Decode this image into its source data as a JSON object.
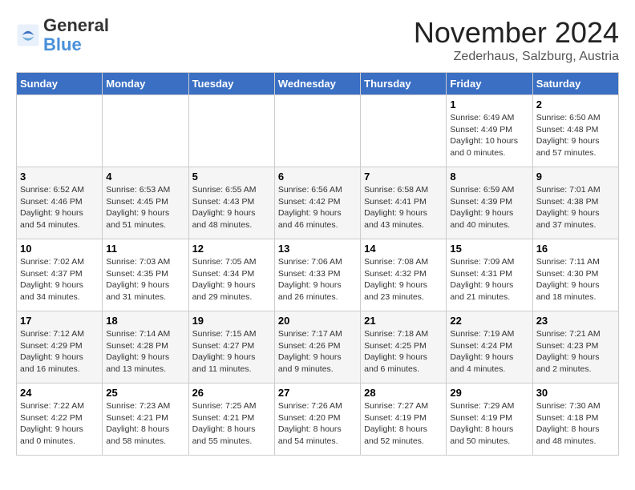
{
  "logo": {
    "text_general": "General",
    "text_blue": "Blue"
  },
  "header": {
    "month_year": "November 2024",
    "location": "Zederhaus, Salzburg, Austria"
  },
  "days_of_week": [
    "Sunday",
    "Monday",
    "Tuesday",
    "Wednesday",
    "Thursday",
    "Friday",
    "Saturday"
  ],
  "weeks": [
    [
      {
        "day": "",
        "info": ""
      },
      {
        "day": "",
        "info": ""
      },
      {
        "day": "",
        "info": ""
      },
      {
        "day": "",
        "info": ""
      },
      {
        "day": "",
        "info": ""
      },
      {
        "day": "1",
        "info": "Sunrise: 6:49 AM\nSunset: 4:49 PM\nDaylight: 10 hours and 0 minutes."
      },
      {
        "day": "2",
        "info": "Sunrise: 6:50 AM\nSunset: 4:48 PM\nDaylight: 9 hours and 57 minutes."
      }
    ],
    [
      {
        "day": "3",
        "info": "Sunrise: 6:52 AM\nSunset: 4:46 PM\nDaylight: 9 hours and 54 minutes."
      },
      {
        "day": "4",
        "info": "Sunrise: 6:53 AM\nSunset: 4:45 PM\nDaylight: 9 hours and 51 minutes."
      },
      {
        "day": "5",
        "info": "Sunrise: 6:55 AM\nSunset: 4:43 PM\nDaylight: 9 hours and 48 minutes."
      },
      {
        "day": "6",
        "info": "Sunrise: 6:56 AM\nSunset: 4:42 PM\nDaylight: 9 hours and 46 minutes."
      },
      {
        "day": "7",
        "info": "Sunrise: 6:58 AM\nSunset: 4:41 PM\nDaylight: 9 hours and 43 minutes."
      },
      {
        "day": "8",
        "info": "Sunrise: 6:59 AM\nSunset: 4:39 PM\nDaylight: 9 hours and 40 minutes."
      },
      {
        "day": "9",
        "info": "Sunrise: 7:01 AM\nSunset: 4:38 PM\nDaylight: 9 hours and 37 minutes."
      }
    ],
    [
      {
        "day": "10",
        "info": "Sunrise: 7:02 AM\nSunset: 4:37 PM\nDaylight: 9 hours and 34 minutes."
      },
      {
        "day": "11",
        "info": "Sunrise: 7:03 AM\nSunset: 4:35 PM\nDaylight: 9 hours and 31 minutes."
      },
      {
        "day": "12",
        "info": "Sunrise: 7:05 AM\nSunset: 4:34 PM\nDaylight: 9 hours and 29 minutes."
      },
      {
        "day": "13",
        "info": "Sunrise: 7:06 AM\nSunset: 4:33 PM\nDaylight: 9 hours and 26 minutes."
      },
      {
        "day": "14",
        "info": "Sunrise: 7:08 AM\nSunset: 4:32 PM\nDaylight: 9 hours and 23 minutes."
      },
      {
        "day": "15",
        "info": "Sunrise: 7:09 AM\nSunset: 4:31 PM\nDaylight: 9 hours and 21 minutes."
      },
      {
        "day": "16",
        "info": "Sunrise: 7:11 AM\nSunset: 4:30 PM\nDaylight: 9 hours and 18 minutes."
      }
    ],
    [
      {
        "day": "17",
        "info": "Sunrise: 7:12 AM\nSunset: 4:29 PM\nDaylight: 9 hours and 16 minutes."
      },
      {
        "day": "18",
        "info": "Sunrise: 7:14 AM\nSunset: 4:28 PM\nDaylight: 9 hours and 13 minutes."
      },
      {
        "day": "19",
        "info": "Sunrise: 7:15 AM\nSunset: 4:27 PM\nDaylight: 9 hours and 11 minutes."
      },
      {
        "day": "20",
        "info": "Sunrise: 7:17 AM\nSunset: 4:26 PM\nDaylight: 9 hours and 9 minutes."
      },
      {
        "day": "21",
        "info": "Sunrise: 7:18 AM\nSunset: 4:25 PM\nDaylight: 9 hours and 6 minutes."
      },
      {
        "day": "22",
        "info": "Sunrise: 7:19 AM\nSunset: 4:24 PM\nDaylight: 9 hours and 4 minutes."
      },
      {
        "day": "23",
        "info": "Sunrise: 7:21 AM\nSunset: 4:23 PM\nDaylight: 9 hours and 2 minutes."
      }
    ],
    [
      {
        "day": "24",
        "info": "Sunrise: 7:22 AM\nSunset: 4:22 PM\nDaylight: 9 hours and 0 minutes."
      },
      {
        "day": "25",
        "info": "Sunrise: 7:23 AM\nSunset: 4:21 PM\nDaylight: 8 hours and 58 minutes."
      },
      {
        "day": "26",
        "info": "Sunrise: 7:25 AM\nSunset: 4:21 PM\nDaylight: 8 hours and 55 minutes."
      },
      {
        "day": "27",
        "info": "Sunrise: 7:26 AM\nSunset: 4:20 PM\nDaylight: 8 hours and 54 minutes."
      },
      {
        "day": "28",
        "info": "Sunrise: 7:27 AM\nSunset: 4:19 PM\nDaylight: 8 hours and 52 minutes."
      },
      {
        "day": "29",
        "info": "Sunrise: 7:29 AM\nSunset: 4:19 PM\nDaylight: 8 hours and 50 minutes."
      },
      {
        "day": "30",
        "info": "Sunrise: 7:30 AM\nSunset: 4:18 PM\nDaylight: 8 hours and 48 minutes."
      }
    ]
  ]
}
